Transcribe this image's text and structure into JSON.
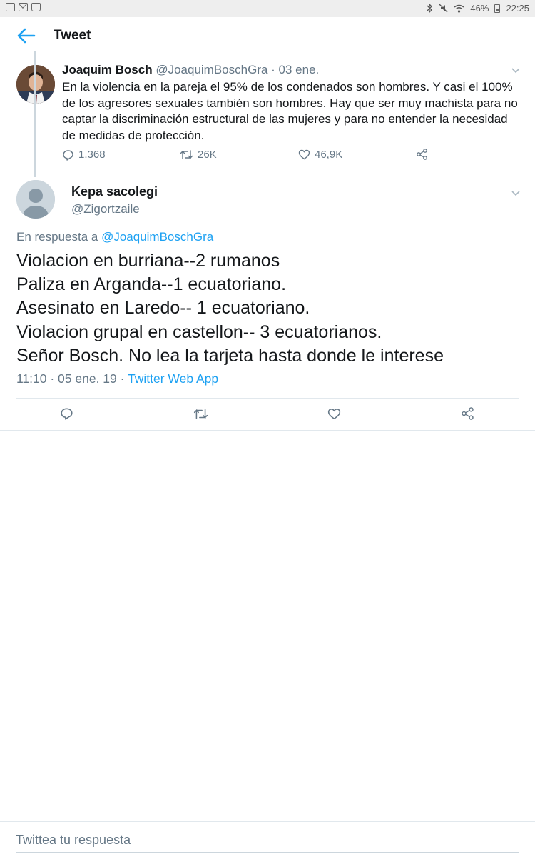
{
  "status_bar": {
    "left_icons": [
      "image-icon",
      "mail-icon",
      "shopping-bag-icon"
    ],
    "right_icons": [
      "bluetooth-icon",
      "mute-icon",
      "wifi-icon",
      "battery-icon"
    ],
    "battery": "46%",
    "time": "22:25"
  },
  "header": {
    "title": "Tweet",
    "back_icon": "back-arrow-icon"
  },
  "parent_tweet": {
    "name": "Joaquim Bosch",
    "handle": "@JoaquimBoschGra",
    "date": " · 03 ene.",
    "text": "En la violencia en la pareja el 95% de los condenados son hombres. Y casi el 100% de los agresores sexuales también son hombres. Hay que ser muy machista para no captar la discriminación estructural de las mujeres y para no entender la necesidad de medidas de protección.",
    "replies": "1.368",
    "retweets": "26K",
    "likes": "46,9K"
  },
  "reply_tweet": {
    "name": "Kepa sacolegi",
    "handle": "@Zigortzaile",
    "in_reply_prefix": "En respuesta a ",
    "in_reply_mention": "@JoaquimBoschGra",
    "lines": [
      "Violacion en burriana--2 rumanos",
      "Paliza en Arganda--1 ecuatoriano.",
      "Asesinato en Laredo-- 1 ecuatoriano.",
      "Violacion grupal en castellon-- 3 ecuatorianos.",
      "Señor Bosch. No lea la tarjeta hasta donde le interese"
    ],
    "timestamp": "11:10 · 05 ene. 19 · ",
    "app": "Twitter Web App"
  },
  "composer": {
    "placeholder": "Twittea tu respuesta"
  },
  "colors": {
    "accent": "#1da1f2",
    "secondary_text": "#657786",
    "divider": "#e1e8ed"
  }
}
